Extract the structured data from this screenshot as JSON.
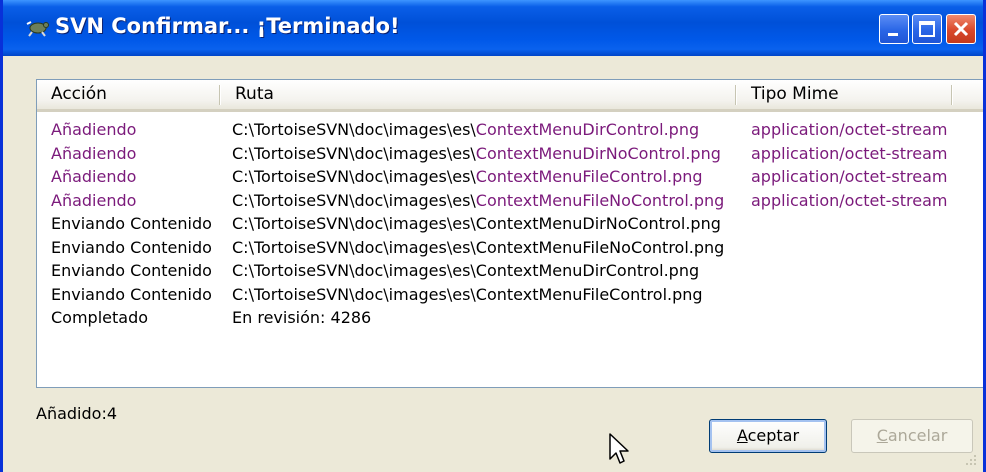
{
  "window": {
    "title": "SVN Confirmar... ¡Terminado!"
  },
  "columns": [
    "Acción",
    "Ruta",
    "Tipo Mime"
  ],
  "rows": [
    {
      "action": "Añadiendo",
      "path_prefix": "C:\\TortoiseSVN\\doc\\images\\es\\",
      "path_file": "ContextMenuDirControl.png",
      "mime": "application/octet-stream",
      "color": "#7b1a7b"
    },
    {
      "action": "Añadiendo",
      "path_prefix": "C:\\TortoiseSVN\\doc\\images\\es\\",
      "path_file": "ContextMenuDirNoControl.png",
      "mime": "application/octet-stream",
      "color": "#7b1a7b"
    },
    {
      "action": "Añadiendo",
      "path_prefix": "C:\\TortoiseSVN\\doc\\images\\es\\",
      "path_file": "ContextMenuFileControl.png",
      "mime": "application/octet-stream",
      "color": "#7b1a7b"
    },
    {
      "action": "Añadiendo",
      "path_prefix": "C:\\TortoiseSVN\\doc\\images\\es\\",
      "path_file": "ContextMenuFileNoControl.png",
      "mime": "application/octet-stream",
      "color": "#7b1a7b"
    },
    {
      "action": "Enviando Contenido",
      "path_prefix": "C:\\TortoiseSVN\\doc\\images\\es\\",
      "path_file": "ContextMenuDirNoControl.png",
      "mime": "",
      "color": "#000000"
    },
    {
      "action": "Enviando Contenido",
      "path_prefix": "C:\\TortoiseSVN\\doc\\images\\es\\",
      "path_file": "ContextMenuFileNoControl.png",
      "mime": "",
      "color": "#000000"
    },
    {
      "action": "Enviando Contenido",
      "path_prefix": "C:\\TortoiseSVN\\doc\\images\\es\\",
      "path_file": "ContextMenuDirControl.png",
      "mime": "",
      "color": "#000000"
    },
    {
      "action": "Enviando Contenido",
      "path_prefix": "C:\\TortoiseSVN\\doc\\images\\es\\",
      "path_file": "ContextMenuFileControl.png",
      "mime": "",
      "color": "#000000"
    },
    {
      "action": "Completado",
      "path_prefix": "En revisión: 4286",
      "path_file": "",
      "mime": "",
      "color": "#000000"
    }
  ],
  "status": "Añadido:4",
  "buttons": {
    "ok": {
      "accel": "A",
      "rest": "ceptar"
    },
    "cancel": {
      "accel": "C",
      "rest": "ancelar"
    }
  },
  "colors": {
    "added": "#7b1a7b",
    "title_bar": "#0058e8"
  },
  "icons": [
    "tortoisesvn-icon",
    "minimize-icon",
    "maximize-icon",
    "close-icon",
    "resize-grip-icon",
    "mouse-cursor-icon"
  ]
}
